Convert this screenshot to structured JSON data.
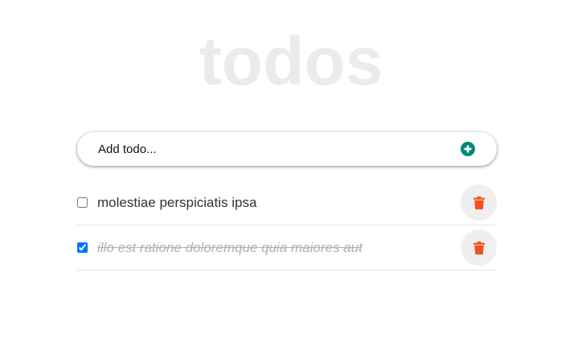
{
  "app": {
    "title": "todos"
  },
  "add_form": {
    "placeholder": "Add todo...",
    "add_icon": "plus-circle-icon",
    "add_icon_color": "#00897b"
  },
  "todos": [
    {
      "text": "molestiae perspiciatis ipsa",
      "completed": false,
      "delete_icon": "trash-icon"
    },
    {
      "text": "illo est ratione doloremque quia maiores aut",
      "completed": true,
      "delete_icon": "trash-icon"
    }
  ],
  "colors": {
    "delete_icon": "#f4511e",
    "title": "#ebebeb",
    "completed_text": "#b0b0b0"
  }
}
